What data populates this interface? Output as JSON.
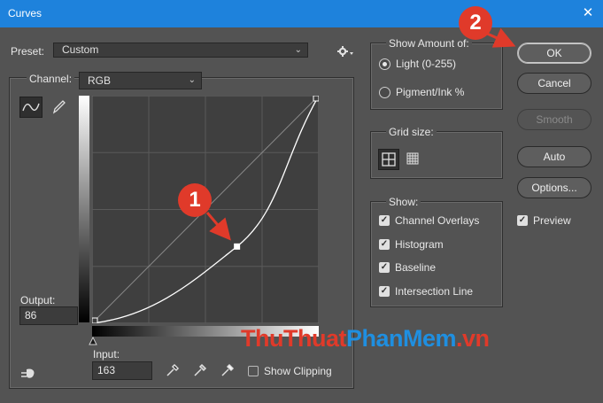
{
  "window": {
    "title": "Curves",
    "close_glyph": "✕"
  },
  "preset": {
    "label": "Preset:",
    "value": "Custom",
    "gear_icon": "gear-icon"
  },
  "channel": {
    "label": "Channel:",
    "value": "RGB"
  },
  "curve": {
    "input": 163,
    "output": 86,
    "points": [
      [
        0,
        0
      ],
      [
        163,
        86
      ],
      [
        255,
        255
      ]
    ]
  },
  "output_field": {
    "label": "Output:",
    "value": "86"
  },
  "input_field": {
    "label": "Input:",
    "value": "163"
  },
  "show_clipping": {
    "label": "Show Clipping",
    "checked": false
  },
  "show_amount": {
    "title": "Show Amount of:",
    "options": [
      {
        "label": "Light  (0-255)",
        "selected": true
      },
      {
        "label": "Pigment/Ink %",
        "selected": false
      }
    ]
  },
  "grid_size": {
    "title": "Grid size:",
    "selected": "quarter"
  },
  "show": {
    "title": "Show:",
    "items": [
      {
        "label": "Channel Overlays",
        "checked": true
      },
      {
        "label": "Histogram",
        "checked": true
      },
      {
        "label": "Baseline",
        "checked": true
      },
      {
        "label": "Intersection Line",
        "checked": true
      }
    ]
  },
  "buttons": {
    "ok": "OK",
    "cancel": "Cancel",
    "smooth": "Smooth",
    "auto": "Auto",
    "options": "Options..."
  },
  "preview": {
    "label": "Preview",
    "checked": true
  },
  "annotations": {
    "badge1": "1",
    "badge2": "2",
    "color": "#e03a2a"
  },
  "watermark": {
    "parts": [
      {
        "text": "ThuThuat",
        "color": "#e03a2a"
      },
      {
        "text": "PhanMem",
        "color": "#1f8fe0"
      },
      {
        "text": ".vn",
        "color": "#e03a2a"
      }
    ]
  }
}
